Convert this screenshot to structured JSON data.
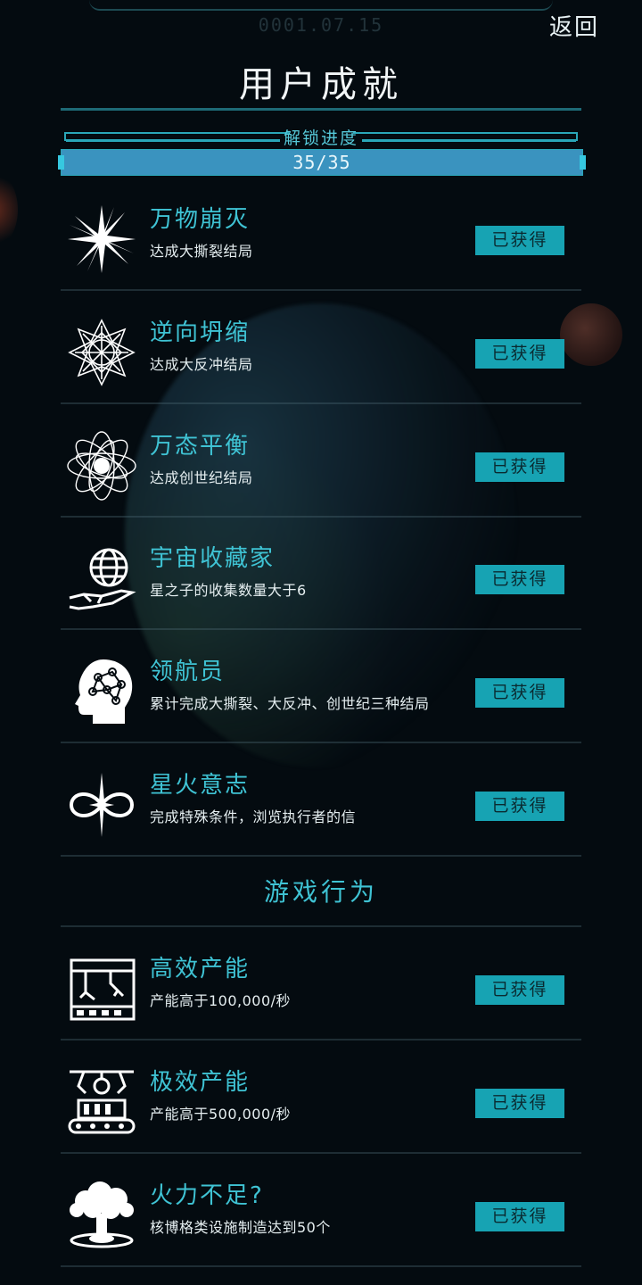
{
  "header": {
    "date": "0001.07.15",
    "back_label": "返回",
    "title": "用户成就"
  },
  "progress": {
    "label": "解锁进度",
    "text": "35/35",
    "fraction": 1.0
  },
  "achievements": [
    {
      "name": "万物崩灭",
      "desc": "达成大撕裂结局",
      "status": "已获得",
      "icon": "starburst-icon"
    },
    {
      "name": "逆向坍缩",
      "desc": "达成大反冲结局",
      "status": "已获得",
      "icon": "mandala-icon"
    },
    {
      "name": "万态平衡",
      "desc": "达成创世纪结局",
      "status": "已获得",
      "icon": "atom-orbit-icon"
    },
    {
      "name": "宇宙收藏家",
      "desc": "星之子的收集数量大于6",
      "status": "已获得",
      "icon": "hand-sphere-icon"
    },
    {
      "name": "领航员",
      "desc": "累计完成大撕裂、大反冲、创世纪三种结局",
      "status": "已获得",
      "icon": "brain-head-icon"
    },
    {
      "name": "星火意志",
      "desc": "完成特殊条件，浏览执行者的信",
      "status": "已获得",
      "icon": "infinity-star-icon"
    }
  ],
  "section": {
    "title": "游戏行为"
  },
  "behaviors": [
    {
      "name": "高效产能",
      "desc": "产能高于100,000/秒",
      "status": "已获得",
      "icon": "factory-arm-icon"
    },
    {
      "name": "极效产能",
      "desc": "产能高于500,000/秒",
      "status": "已获得",
      "icon": "assembly-line-icon"
    },
    {
      "name": "火力不足?",
      "desc": "核博格类设施制造达到50个",
      "status": "已获得",
      "icon": "mushroom-cloud-icon"
    }
  ],
  "colors": {
    "accent": "#3fc3d4",
    "badge": "#17a3b3",
    "progress_fill": "#3a93bf",
    "background": "#040b10"
  }
}
